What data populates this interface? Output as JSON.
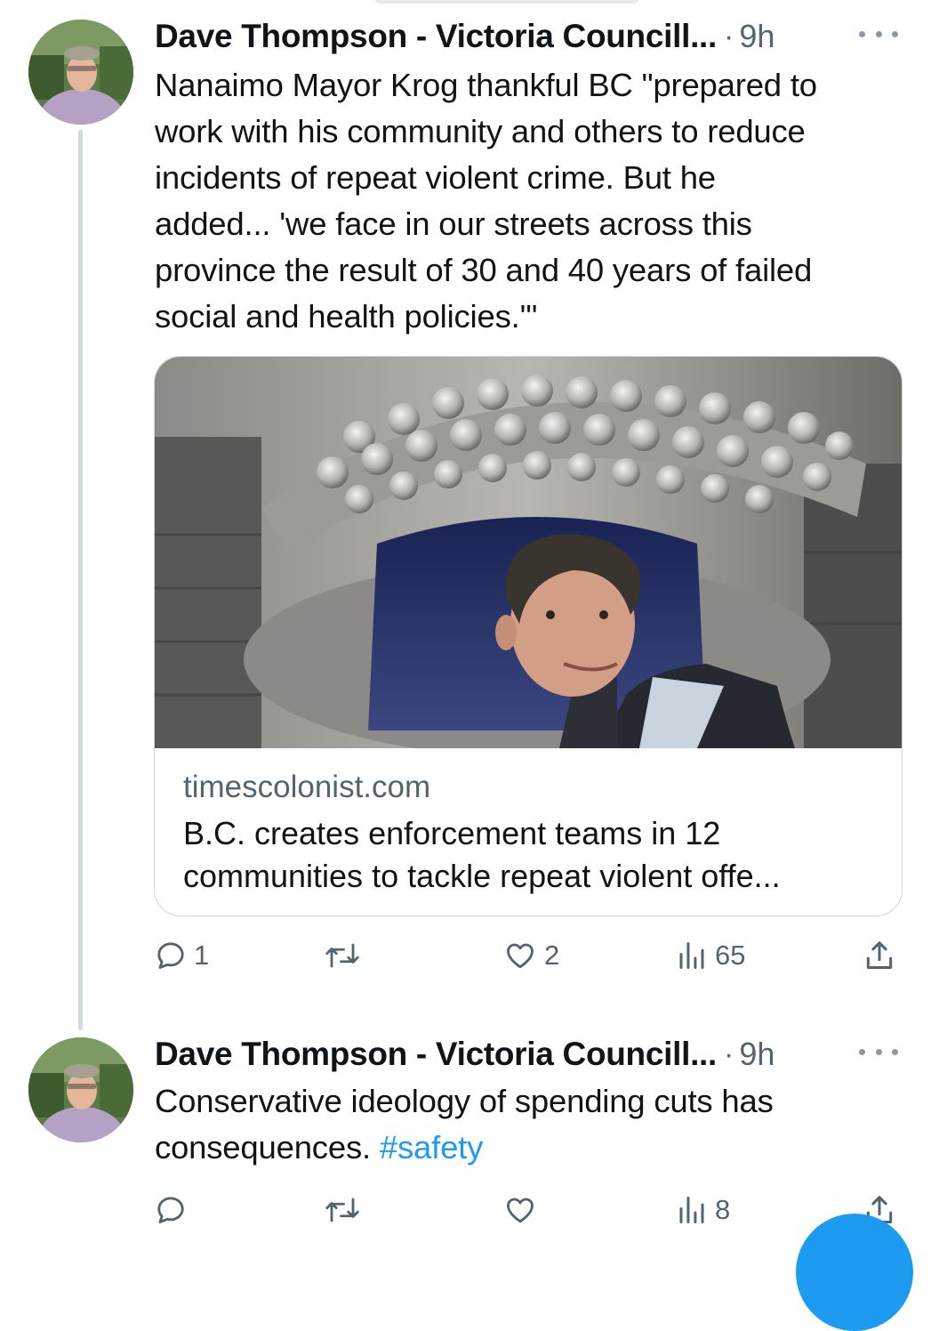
{
  "tweets": [
    {
      "author": "Dave Thompson - Victoria Councill...",
      "separator": "·",
      "time": "9h",
      "text_lines": [
        "Nanaimo Mayor Krog thankful BC \"prepared to",
        "work with his community and others to reduce",
        "incidents of repeat violent crime. But he",
        "added... 'we face in our streets across this",
        "province the result of 30 and 40 years of failed",
        "social and health policies.'\""
      ],
      "card": {
        "domain": "timescolonist.com",
        "title_lines": [
          "B.C. creates enforcement teams in 12",
          "communities to tackle repeat violent offe..."
        ]
      },
      "actions": {
        "replies": "1",
        "reposts": "",
        "likes": "2",
        "views": "65"
      }
    },
    {
      "author": "Dave Thompson - Victoria Councill...",
      "separator": "·",
      "time": "9h",
      "text_line_1": "Conservative ideology of spending cuts has",
      "text_line_2_prefix": "consequences. ",
      "hashtag": "#safety",
      "actions": {
        "replies": "",
        "reposts": "",
        "likes": "",
        "views": "8"
      }
    }
  ],
  "icons": [
    "reply-icon",
    "repost-icon",
    "like-icon",
    "views-icon",
    "share-icon",
    "more-icon"
  ],
  "colors": {
    "text": "#0f1419",
    "secondary": "#536471",
    "accent": "#1d9bf0",
    "border": "#cfd9de"
  }
}
